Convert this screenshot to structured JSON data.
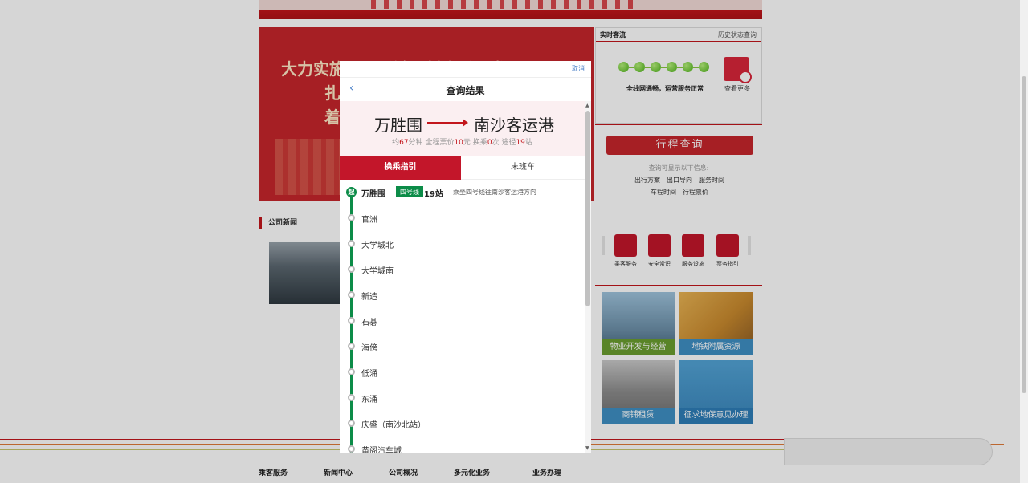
{
  "hero": {
    "line1": "大力实施工号乐链工村高质量发展工程",
    "line2": "扎",
    "line3": "着"
  },
  "realtime": {
    "tab_active": "实时客流",
    "tab_history": "历史状态查询",
    "status": "全线网通畅，运营服务正常",
    "more": "查看更多"
  },
  "trip": {
    "button": "行程查询",
    "hint": "查询可显示以下信息:",
    "links_row1": [
      "出行方案",
      "出口导向",
      "服务时间"
    ],
    "links_row2": [
      "车程时间",
      "行程票价"
    ]
  },
  "services": [
    "乘客服务",
    "安全常识",
    "服务设施",
    "票务指引"
  ],
  "tiles": [
    "物业开发与经营",
    "地铁附属资源",
    "商铺租赁",
    "征求地保意见办理"
  ],
  "news": {
    "title": "公司新闻"
  },
  "footer_nav": [
    "乘客服务",
    "新闻中心",
    "公司概况",
    "多元化业务",
    "业务办理"
  ],
  "modal": {
    "cancel": "取消",
    "back": "‹",
    "title": "查询结果",
    "from": "万胜围",
    "to": "南沙客运港",
    "summary": {
      "prefix": "约",
      "minutes": "67",
      "minutes_unit": "分钟",
      "fare_label": "全程票价",
      "fare": "10",
      "fare_unit": "元",
      "transfer_label": "换乘",
      "transfers": "0",
      "transfer_unit": "次",
      "stops_label": "途径",
      "stops": "19",
      "stops_unit": "站"
    },
    "tab_active": "换乘指引",
    "tab_other": "末班车",
    "start_marker": "起",
    "line_badge": "四号线",
    "station_count": "19站",
    "direction": "乘坐四号线往南沙客运港方向",
    "stations": [
      "万胜围",
      "官洲",
      "大学城北",
      "大学城南",
      "新造",
      "石碁",
      "海傍",
      "低涌",
      "东涌",
      "庆盛（南沙北站）",
      "黄阁汽车城"
    ]
  },
  "colors": {
    "brand_red": "#c3161c",
    "line4_green": "#0c8c48",
    "link_blue": "#3f78c4"
  }
}
